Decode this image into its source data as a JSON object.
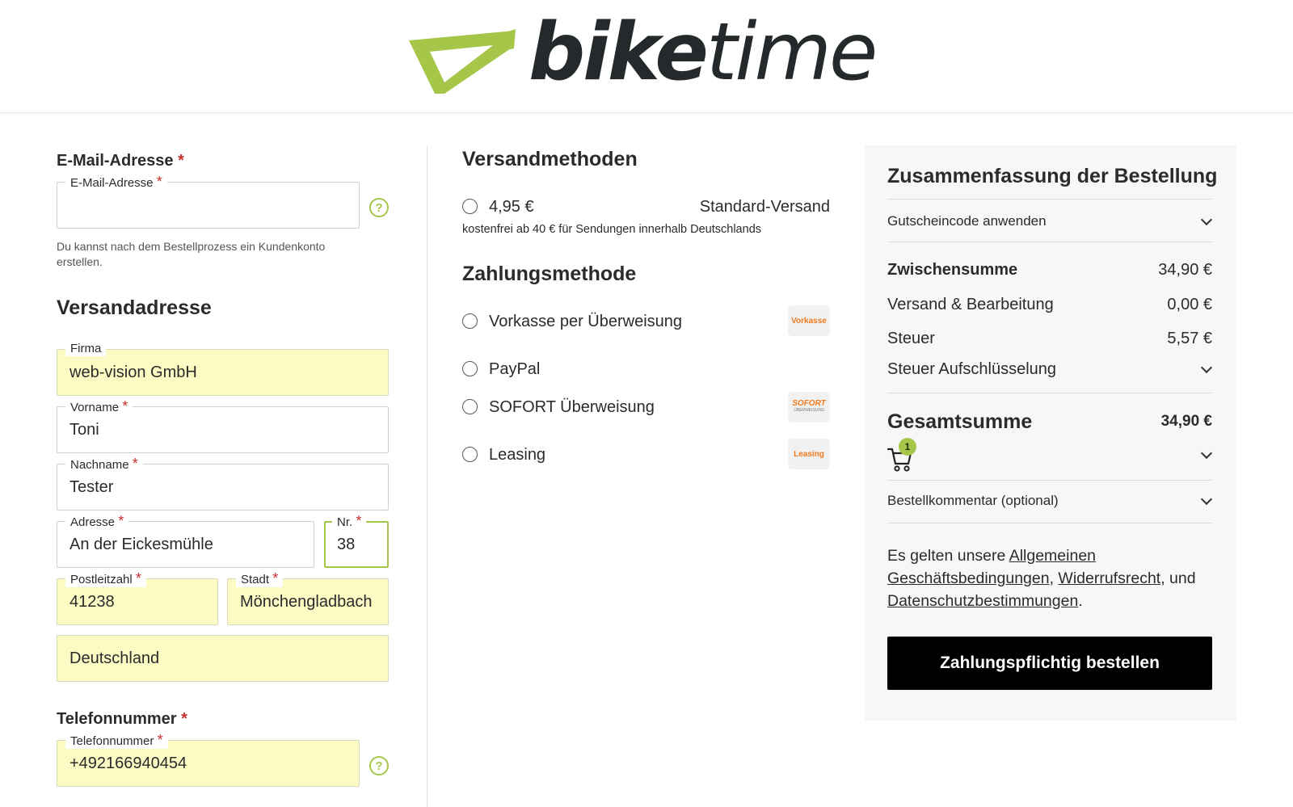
{
  "brand": {
    "logo_text_bold": "bike",
    "logo_text_light": "time",
    "accent_color": "#a6c64a",
    "dark_color": "#242a2c"
  },
  "email_section": {
    "title": "E-Mail-Adresse",
    "required_mark": "*",
    "field_label": "E-Mail-Adresse",
    "field_value": "",
    "hint": "Du kannst nach dem Bestellprozess ein Kundenkonto erstellen."
  },
  "shipping_address": {
    "title": "Versandadresse",
    "company": {
      "label": "Firma",
      "value": "web-vision GmbH"
    },
    "first_name": {
      "label": "Vorname",
      "value": "Toni"
    },
    "last_name": {
      "label": "Nachname",
      "value": "Tester"
    },
    "street": {
      "label": "Adresse",
      "value": "An der Eickesmühle"
    },
    "number": {
      "label": "Nr.",
      "value": "38"
    },
    "zip": {
      "label": "Postleitzahl",
      "value": "41238"
    },
    "city": {
      "label": "Stadt",
      "value": "Mönchengladbach"
    },
    "country": {
      "value": "Deutschland"
    }
  },
  "phone_section": {
    "title": "Telefonnummer",
    "field_label": "Telefonnummer",
    "field_value": "+492166940454"
  },
  "shipping_methods": {
    "title": "Versandmethoden",
    "options": [
      {
        "price": "4,95 €",
        "name": "Standard-Versand",
        "note": "kostenfrei ab 40 € für Sendungen innerhalb Deutschlands"
      }
    ]
  },
  "payment_methods": {
    "title": "Zahlungsmethode",
    "options": [
      {
        "label": "Vorkasse per Überweisung",
        "logo": "Vorkasse"
      },
      {
        "label": "PayPal",
        "logo": ""
      },
      {
        "label": "SOFORT Überweisung",
        "logo": "SOFORT",
        "logo_sub": "ÜBERWEISUNG"
      },
      {
        "label": "Leasing",
        "logo": "Leasing"
      }
    ]
  },
  "summary": {
    "title": "Zusammenfassung der Bestellung",
    "coupon_label": "Gutscheincode anwenden",
    "subtotal_label": "Zwischensumme",
    "subtotal_value": "34,90 €",
    "shipping_label": "Versand & Bearbeitung",
    "shipping_value": "0,00 €",
    "tax_label": "Steuer",
    "tax_value": "5,57 €",
    "tax_breakdown_label": "Steuer Aufschlüsselung",
    "total_label": "Gesamtsumme",
    "total_value": "34,90 €",
    "cart_count": "1",
    "comment_label": "Bestellkommentar (optional)",
    "terms_prefix": "Es gelten unsere ",
    "terms_link1": "Allgemeinen Geschäftsbedingungen",
    "terms_sep1": ", ",
    "terms_link2": "Widerrufsrecht",
    "terms_sep2": ", und ",
    "terms_link3": "Datenschutzbestimmungen",
    "terms_suffix": ".",
    "order_button": "Zahlungspflichtig bestellen"
  }
}
